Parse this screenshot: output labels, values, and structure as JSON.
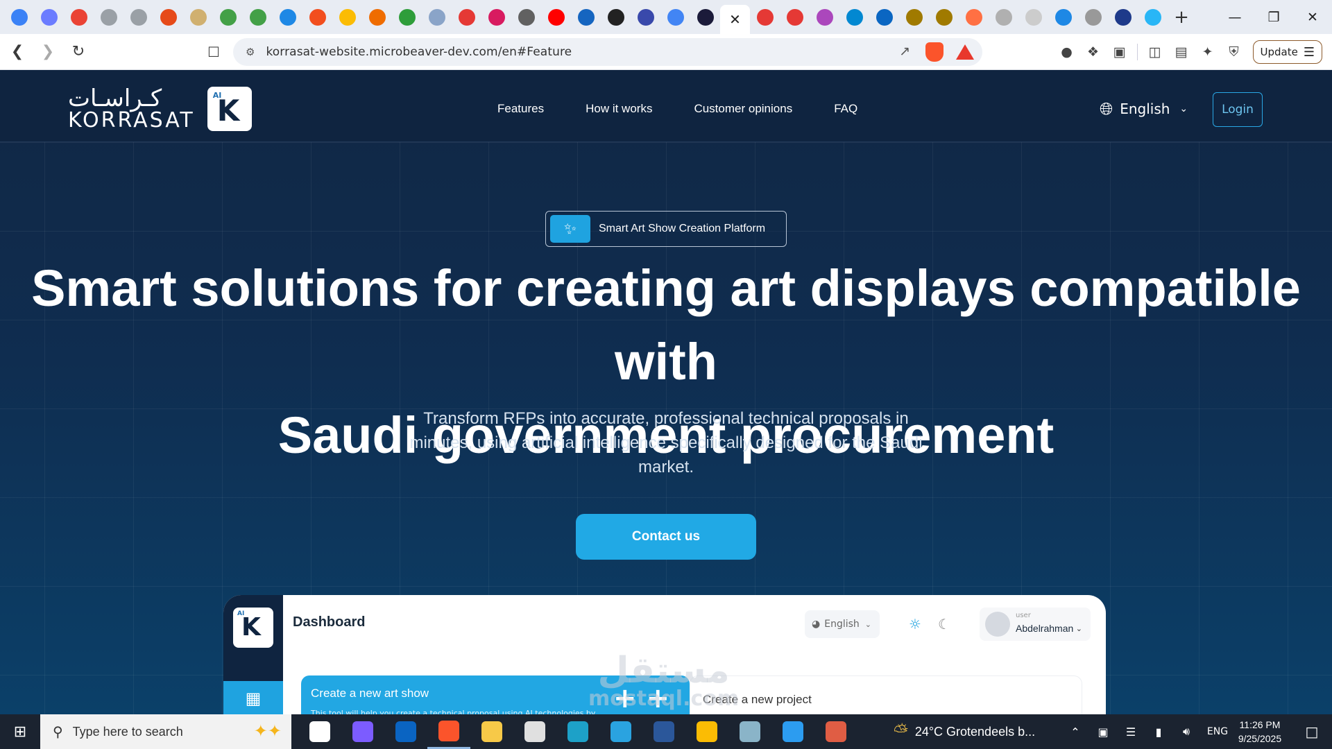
{
  "browser": {
    "tabs": [
      {
        "icon": "app-icon",
        "color": "#3b82f6"
      },
      {
        "icon": "app-icon",
        "color": "#6b7cff"
      },
      {
        "icon": "gmail-icon",
        "color": "#ea4335"
      },
      {
        "icon": "app-icon",
        "color": "#9aa0a6"
      },
      {
        "icon": "app-icon",
        "color": "#9aa0a6"
      },
      {
        "icon": "app-icon",
        "color": "#e64a19"
      },
      {
        "icon": "app-icon",
        "color": "#d0b070"
      },
      {
        "icon": "app-icon",
        "color": "#43a047"
      },
      {
        "icon": "app-icon",
        "color": "#43a047"
      },
      {
        "icon": "app-icon",
        "color": "#1e88e5"
      },
      {
        "icon": "figma-icon",
        "color": "#f24e1e"
      },
      {
        "icon": "app-icon",
        "color": "#fbbc04"
      },
      {
        "icon": "app-icon",
        "color": "#ef6c00"
      },
      {
        "icon": "app-icon",
        "color": "#2e9d3a"
      },
      {
        "icon": "app-icon",
        "color": "#8aa4c8"
      },
      {
        "icon": "app-icon",
        "color": "#e53935"
      },
      {
        "icon": "app-icon",
        "color": "#d81b60"
      },
      {
        "icon": "app-icon",
        "color": "#616161"
      },
      {
        "icon": "youtube-icon",
        "color": "#ff0000"
      },
      {
        "icon": "app-icon",
        "color": "#1565c0"
      },
      {
        "icon": "openai-icon",
        "color": "#222222"
      },
      {
        "icon": "app-icon",
        "color": "#3949ab"
      },
      {
        "icon": "translate-icon",
        "color": "#4285f4"
      },
      {
        "icon": "app-icon",
        "color": "#1b1b3a"
      },
      {
        "icon": "close-icon",
        "color": "#222222",
        "active": true
      },
      {
        "icon": "app-icon",
        "color": "#e53935"
      },
      {
        "icon": "app-icon",
        "color": "#e53935"
      },
      {
        "icon": "app-icon",
        "color": "#ab47bc"
      },
      {
        "icon": "app-icon",
        "color": "#0288d1"
      },
      {
        "icon": "linkedin-icon",
        "color": "#0a66c2"
      },
      {
        "icon": "vuetify-icon",
        "color": "#a07a00"
      },
      {
        "icon": "vuetify-icon",
        "color": "#a07a00"
      },
      {
        "icon": "app-icon",
        "color": "#ff7043"
      },
      {
        "icon": "app-icon",
        "color": "#b0b0b0"
      },
      {
        "icon": "apple-icon",
        "color": "#cccccc"
      },
      {
        "icon": "app-icon",
        "color": "#1e88e5"
      },
      {
        "icon": "notion-icon",
        "color": "#999999"
      },
      {
        "icon": "app-icon",
        "color": "#1e3a8a"
      },
      {
        "icon": "app-icon",
        "color": "#29b6f6"
      }
    ],
    "new_tab": "+",
    "url": "korrasat-website.microbeaver-dev.com/en#Feature",
    "update_label": "Update"
  },
  "site": {
    "logo_ar": "كـراسـات",
    "logo_en": "KORRASAT",
    "logo_badge": "AI",
    "logo_letter": "K",
    "nav": [
      "Features",
      "How it works",
      "Customer opinions",
      "FAQ"
    ],
    "language": "English",
    "login": "Login",
    "badge": "Smart Art Show Creation Platform",
    "hero_line1": "Smart solutions for creating art displays compatible with",
    "hero_line2": "Saudi government procurement",
    "hero_sub": "Transform RFPs into accurate, professional technical proposals in minutes, using artificial intelligence specifically designed for the Saudi market.",
    "cta": "Contact us",
    "accent": "#21a9e5",
    "navy": "#0f2440"
  },
  "dashboard": {
    "title": "Dashboard",
    "language": "English",
    "user_role": "user",
    "user_name": "Abdelrahman",
    "card1_title": "Create a new art show",
    "card1_desc": "This tool will help you create a technical proposal using AI technologies by",
    "card2_title": "Create a new project"
  },
  "watermark": {
    "ar": "مستقل",
    "en": "mostaql.com"
  },
  "taskbar": {
    "search_placeholder": "Type here to search",
    "apps": [
      {
        "icon": "task-view-icon",
        "color": "#ffffff"
      },
      {
        "icon": "copilot-icon",
        "color": "#7c5cff"
      },
      {
        "icon": "outlook-icon",
        "color": "#0a64c2"
      },
      {
        "icon": "brave-icon",
        "color": "#fb542b",
        "active": true
      },
      {
        "icon": "file-explorer-icon",
        "color": "#f7c948"
      },
      {
        "icon": "store-icon",
        "color": "#e0e0e0"
      },
      {
        "icon": "edge-icon",
        "color": "#1da1c8"
      },
      {
        "icon": "telegram-icon",
        "color": "#2aa3e0"
      },
      {
        "icon": "word-icon",
        "color": "#2b579a"
      },
      {
        "icon": "chrome-icon",
        "color": "#fbbc04"
      },
      {
        "icon": "app-icon",
        "color": "#8ab4c8"
      },
      {
        "icon": "vscode-icon",
        "color": "#2c9cf0"
      },
      {
        "icon": "git-icon",
        "color": "#e05d44"
      }
    ],
    "weather": "24°C  Grotendeels b...",
    "lang": "ENG",
    "time": "11:26 PM",
    "date": "9/25/2025"
  }
}
